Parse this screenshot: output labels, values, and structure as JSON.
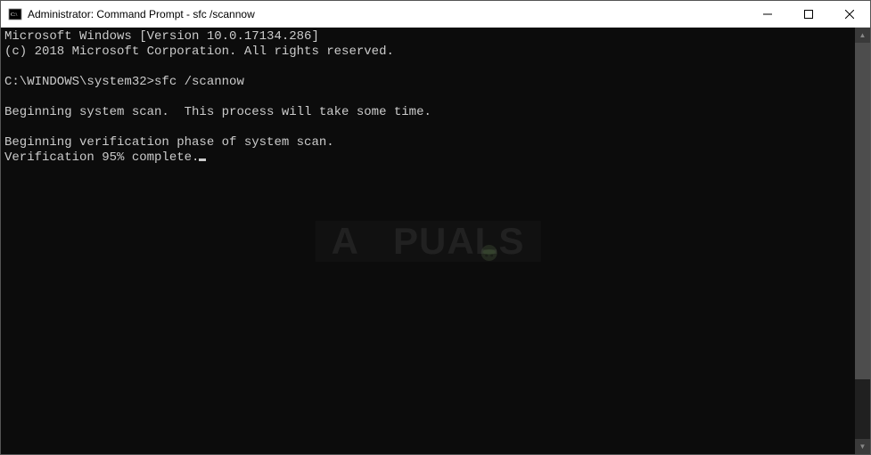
{
  "window": {
    "title": "Administrator: Command Prompt - sfc  /scannow"
  },
  "terminal": {
    "lines": {
      "version": "Microsoft Windows [Version 10.0.17134.286]",
      "copyright": "(c) 2018 Microsoft Corporation. All rights reserved.",
      "blank1": "",
      "prompt_cmd": "C:\\WINDOWS\\system32>sfc /scannow",
      "blank2": "",
      "begin_scan": "Beginning system scan.  This process will take some time.",
      "blank3": "",
      "begin_verify": "Beginning verification phase of system scan.",
      "verify_pct": "Verification 95% complete."
    }
  },
  "watermark": {
    "text_left": "A",
    "text_right": "PUALS"
  }
}
